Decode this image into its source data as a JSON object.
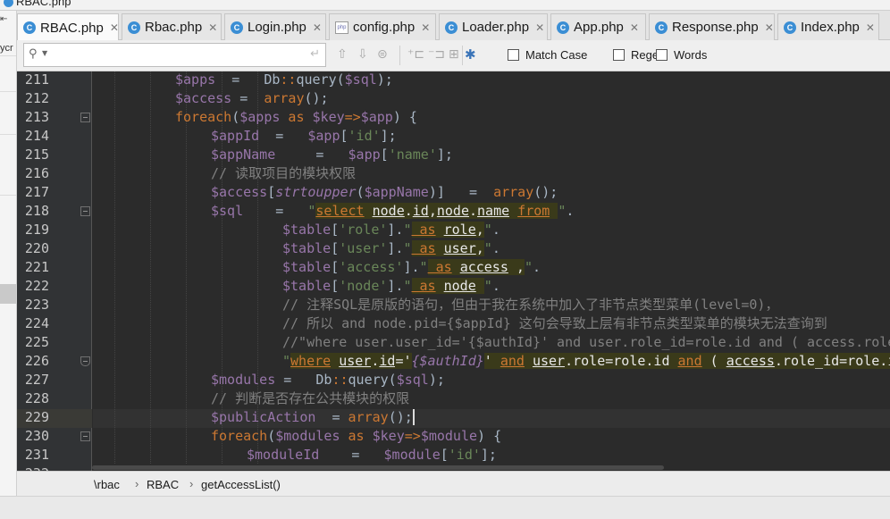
{
  "window": {
    "title": "RBAC.php"
  },
  "left_strip": {
    "label": "ycr"
  },
  "tabs": [
    {
      "label": "RBAC.php",
      "icon": "class-file-icon",
      "active": true
    },
    {
      "label": "Rbac.php",
      "icon": "class-file-icon",
      "active": false
    },
    {
      "label": "Login.php",
      "icon": "class-file-icon",
      "active": false
    },
    {
      "label": "config.php",
      "icon": "php-file-icon",
      "active": false
    },
    {
      "label": "Loader.php",
      "icon": "class-file-icon",
      "active": false
    },
    {
      "label": "App.php",
      "icon": "class-file-icon",
      "active": false
    },
    {
      "label": "Response.php",
      "icon": "class-file-icon",
      "active": false
    },
    {
      "label": "Index.php",
      "icon": "class-file-icon",
      "active": false
    }
  ],
  "search": {
    "value": "",
    "placeholder": "",
    "options": [
      {
        "label": "Match Case",
        "checked": false
      },
      {
        "label": "Regex",
        "checked": false
      },
      {
        "label": "Words",
        "checked": false
      }
    ]
  },
  "editor": {
    "current_line": 229,
    "lines": [
      {
        "n": 211,
        "fold": "",
        "segs": [
          [
            "v",
            "$apps"
          ],
          [
            "",
            "  =   "
          ],
          [
            "fn",
            "Db"
          ],
          [
            "k",
            "::"
          ],
          [
            "fn",
            "query("
          ],
          [
            "v",
            "$sql"
          ],
          [
            "",
            ");"
          ]
        ]
      },
      {
        "n": 212,
        "fold": "",
        "segs": [
          [
            "v",
            "$access"
          ],
          [
            "",
            " =  "
          ],
          [
            "k",
            "array"
          ],
          [
            "",
            "();"
          ]
        ]
      },
      {
        "n": 213,
        "fold": "open",
        "segs": [
          [
            "k",
            "foreach"
          ],
          [
            "",
            "("
          ],
          [
            "v",
            "$apps"
          ],
          [
            "k",
            " as "
          ],
          [
            "v",
            "$key"
          ],
          [
            "k",
            "=>"
          ],
          [
            "v",
            "$app"
          ],
          [
            "",
            ") {"
          ]
        ]
      },
      {
        "n": 214,
        "fold": "",
        "segs": [
          [
            "v",
            "$appId"
          ],
          [
            "",
            "  =   "
          ],
          [
            "v",
            "$app"
          ],
          [
            "",
            "["
          ],
          [
            "s",
            "'id'"
          ],
          [
            "",
            "];"
          ]
        ]
      },
      {
        "n": 215,
        "fold": "",
        "segs": [
          [
            "v",
            "$appName"
          ],
          [
            "",
            "     =   "
          ],
          [
            "v",
            "$app"
          ],
          [
            "",
            "["
          ],
          [
            "s",
            "'name'"
          ],
          [
            "",
            "];"
          ]
        ]
      },
      {
        "n": 216,
        "fold": "",
        "segs": [
          [
            "c",
            "// 读取项目的模块权限"
          ]
        ]
      },
      {
        "n": 217,
        "fold": "",
        "segs": [
          [
            "v",
            "$access"
          ],
          [
            "",
            "["
          ],
          [
            "it",
            "strtoupper"
          ],
          [
            "",
            "("
          ],
          [
            "v",
            "$appName"
          ],
          [
            "",
            ")]   =  "
          ],
          [
            "k",
            "array"
          ],
          [
            "",
            "();"
          ]
        ]
      },
      {
        "n": 218,
        "fold": "open",
        "segs": [
          [
            "v",
            "$sql"
          ],
          [
            "",
            "    =   "
          ],
          [
            "s",
            "\""
          ],
          [
            "sqlkw",
            "select"
          ],
          [
            "sqlp",
            " "
          ],
          [
            "sqlid",
            "node"
          ],
          [
            "sqlp",
            "."
          ],
          [
            "sqlid",
            "id"
          ],
          [
            "sqlp",
            ","
          ],
          [
            "sqlid",
            "node"
          ],
          [
            "sqlp",
            "."
          ],
          [
            "sqlid",
            "name"
          ],
          [
            "sqlp",
            " "
          ],
          [
            "sqlkw",
            "from"
          ],
          [
            "sqlp",
            " "
          ],
          [
            "s",
            "\""
          ],
          [
            "",
            "."
          ]
        ]
      },
      {
        "n": 219,
        "fold": "",
        "segs": [
          [
            "v",
            "$table"
          ],
          [
            "",
            "["
          ],
          [
            "s",
            "'role'"
          ],
          [
            "",
            "]."
          ],
          [
            "s",
            "\""
          ],
          [
            "sqlkw",
            " as"
          ],
          [
            "sqlp",
            " "
          ],
          [
            "sqlid",
            "role"
          ],
          [
            "sqlp",
            ","
          ],
          [
            "s",
            "\""
          ],
          [
            "",
            "."
          ]
        ]
      },
      {
        "n": 220,
        "fold": "",
        "segs": [
          [
            "v",
            "$table"
          ],
          [
            "",
            "["
          ],
          [
            "s",
            "'user'"
          ],
          [
            "",
            "]."
          ],
          [
            "s",
            "\""
          ],
          [
            "sqlkw",
            " as"
          ],
          [
            "sqlp",
            " "
          ],
          [
            "sqlid",
            "user"
          ],
          [
            "sqlp",
            ","
          ],
          [
            "s",
            "\""
          ],
          [
            "",
            "."
          ]
        ]
      },
      {
        "n": 221,
        "fold": "",
        "segs": [
          [
            "v",
            "$table"
          ],
          [
            "",
            "["
          ],
          [
            "s",
            "'access'"
          ],
          [
            "",
            "]."
          ],
          [
            "s",
            "\""
          ],
          [
            "sqlkw",
            " as"
          ],
          [
            "sqlp",
            " "
          ],
          [
            "sqlid",
            "access"
          ],
          [
            "sqlp",
            " ,"
          ],
          [
            "s",
            "\""
          ],
          [
            "",
            "."
          ]
        ]
      },
      {
        "n": 222,
        "fold": "",
        "segs": [
          [
            "v",
            "$table"
          ],
          [
            "",
            "["
          ],
          [
            "s",
            "'node'"
          ],
          [
            "",
            "]."
          ],
          [
            "s",
            "\""
          ],
          [
            "sqlkw",
            " as"
          ],
          [
            "sqlp",
            " "
          ],
          [
            "sqlid",
            "node"
          ],
          [
            "sqlp",
            " "
          ],
          [
            "s",
            "\""
          ],
          [
            "",
            "."
          ]
        ]
      },
      {
        "n": 223,
        "fold": "",
        "segs": [
          [
            "c",
            "// 注释SQL是原版的语句，但由于我在系统中加入了非节点类型菜单(level=0)，"
          ]
        ]
      },
      {
        "n": 224,
        "fold": "",
        "segs": [
          [
            "c",
            "// 所以 and node.pid={$appId} 这句会导致上层有非节点类型菜单的模块无法查询到"
          ]
        ]
      },
      {
        "n": 225,
        "fold": "",
        "segs": [
          [
            "c",
            "//\"where user.user_id='{$authId}' and user.role_id=role.id and ( access.role_id=role.id"
          ]
        ]
      },
      {
        "n": 226,
        "fold": "end",
        "segs": [
          [
            "s",
            "\""
          ],
          [
            "sqlkw",
            "where"
          ],
          [
            "sqlp",
            " "
          ],
          [
            "sqlid",
            "user"
          ],
          [
            "sqlp",
            "."
          ],
          [
            "sqlid",
            "id"
          ],
          [
            "sqlp",
            "='"
          ],
          [
            "it",
            "{$authId}"
          ],
          [
            "sqlp",
            "' "
          ],
          [
            "sqlkw",
            "and"
          ],
          [
            "sqlp",
            " "
          ],
          [
            "sqlid",
            "user"
          ],
          [
            "sqlp",
            ".role=role.id "
          ],
          [
            "sqlkw",
            "and"
          ],
          [
            "sqlp",
            " ( "
          ],
          [
            "sqlid",
            "access"
          ],
          [
            "sqlp",
            ".role_id=role.id"
          ]
        ]
      },
      {
        "n": 227,
        "fold": "",
        "segs": [
          [
            "v",
            "$modules"
          ],
          [
            "",
            " =   "
          ],
          [
            "fn",
            "Db"
          ],
          [
            "k",
            "::"
          ],
          [
            "fn",
            "query("
          ],
          [
            "v",
            "$sql"
          ],
          [
            "",
            ");"
          ]
        ]
      },
      {
        "n": 228,
        "fold": "",
        "segs": [
          [
            "c",
            "// 判断是否存在公共模块的权限"
          ]
        ]
      },
      {
        "n": 229,
        "fold": "",
        "segs": [
          [
            "v",
            "$publicAction"
          ],
          [
            "",
            "  = "
          ],
          [
            "k",
            "array"
          ],
          [
            "",
            "();"
          ]
        ]
      },
      {
        "n": 230,
        "fold": "open",
        "segs": [
          [
            "k",
            "foreach"
          ],
          [
            "",
            "("
          ],
          [
            "v",
            "$modules"
          ],
          [
            "k",
            " as "
          ],
          [
            "v",
            "$key"
          ],
          [
            "k",
            "=>"
          ],
          [
            "v",
            "$module"
          ],
          [
            "",
            ") {"
          ]
        ]
      },
      {
        "n": 231,
        "fold": "",
        "segs": [
          [
            "v",
            "$moduleId"
          ],
          [
            "",
            "    =   "
          ],
          [
            "v",
            "$module"
          ],
          [
            "",
            "["
          ],
          [
            "s",
            "'id'"
          ],
          [
            "",
            "];"
          ]
        ]
      },
      {
        "n": 232,
        "fold": "",
        "segs": [
          [
            "v",
            "$moduleName"
          ],
          [
            "",
            "  = "
          ],
          [
            "v",
            "$module"
          ],
          [
            "",
            "["
          ],
          [
            "s",
            "'name'"
          ],
          [
            "",
            "];"
          ]
        ]
      }
    ]
  },
  "breadcrumb": [
    "\\rbac",
    "RBAC",
    "getAccessList()"
  ]
}
